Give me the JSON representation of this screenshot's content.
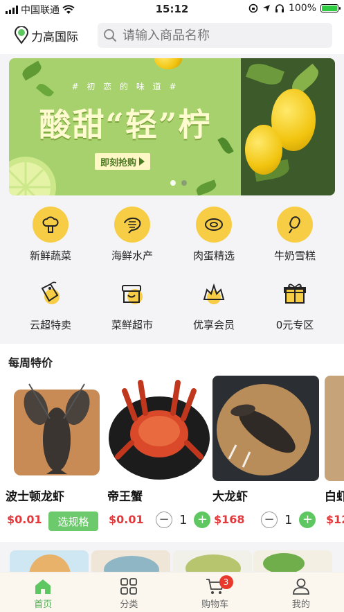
{
  "status_bar": {
    "carrier": "中国联通",
    "time": "15:12",
    "battery": "100%",
    "battery_level": 1.0
  },
  "header": {
    "location": "力高国际",
    "search_placeholder": "请输入商品名称"
  },
  "banner": {
    "tagline": "# 初 恋 的 味 道 #",
    "headline": "酸甜“轻”柠",
    "cta": "即刻抢购",
    "slide_count": 2,
    "active_slide": 1
  },
  "categories": [
    {
      "label": "新鲜蔬菜",
      "icon": "broccoli-icon"
    },
    {
      "label": "海鲜水产",
      "icon": "shrimp-icon"
    },
    {
      "label": "肉蛋精选",
      "icon": "meat-icon"
    },
    {
      "label": "牛奶雪糕",
      "icon": "popsicle-icon"
    },
    {
      "label": "云超特卖",
      "icon": "tag-icon"
    },
    {
      "label": "菜鲜超市",
      "icon": "store-icon"
    },
    {
      "label": "优享会员",
      "icon": "crown-icon"
    },
    {
      "label": "0元专区",
      "icon": "gift-icon"
    }
  ],
  "weekly": {
    "title": "每周特价",
    "products": [
      {
        "name": "波士顿龙虾",
        "price": "$0.01",
        "action": "选规格"
      },
      {
        "name": "帝王蟹",
        "price": "$0.01",
        "qty": "1"
      },
      {
        "name": "大龙虾",
        "price": "$168",
        "qty": "1"
      },
      {
        "name": "白虾",
        "price": "$12"
      }
    ]
  },
  "tabbar": {
    "tabs": [
      {
        "label": "首页",
        "icon": "home-icon",
        "active": true
      },
      {
        "label": "分类",
        "icon": "grid-icon",
        "active": false
      },
      {
        "label": "购物车",
        "icon": "cart-icon",
        "active": false,
        "badge": "3"
      },
      {
        "label": "我的",
        "icon": "user-icon",
        "active": false
      }
    ]
  },
  "colors": {
    "accent_green": "#5ec761",
    "price_red": "#e4393c",
    "icon_yellow": "#f7cd46",
    "badge_red": "#e8392c"
  }
}
